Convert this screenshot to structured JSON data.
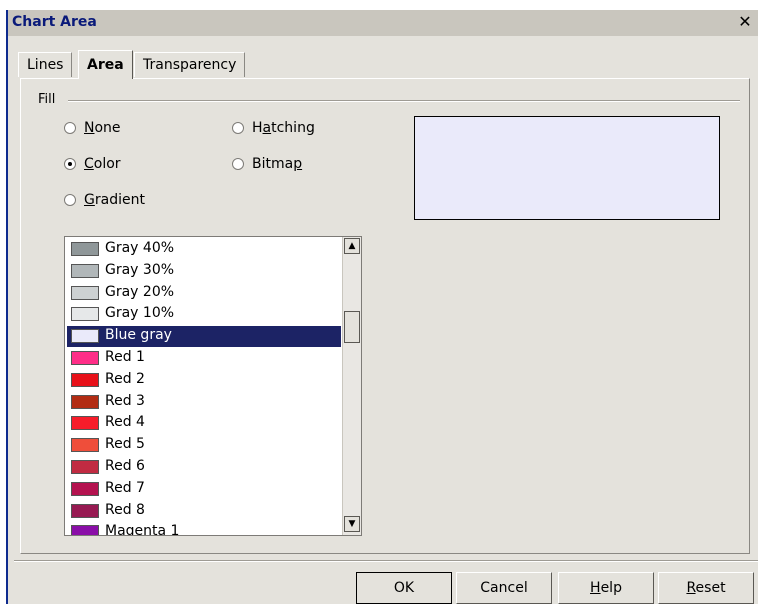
{
  "window": {
    "title": "Chart Area",
    "close_glyph": "✕"
  },
  "tabs": [
    {
      "label": "Lines"
    },
    {
      "label": "Area",
      "active": true
    },
    {
      "label": "Transparency"
    }
  ],
  "fill": {
    "label": "Fill",
    "options": [
      {
        "pre": "",
        "key": "N",
        "post": "one",
        "checked": false
      },
      {
        "pre": "",
        "key": "C",
        "post": "olor",
        "checked": true
      },
      {
        "pre": "",
        "key": "G",
        "post": "radient",
        "checked": false
      },
      {
        "pre": "H",
        "key": "a",
        "post": "tching",
        "checked": false
      },
      {
        "pre": "Bitma",
        "key": "p",
        "post": "",
        "checked": false
      }
    ]
  },
  "preview": {
    "color": "#eaeafa"
  },
  "color_list": {
    "items": [
      {
        "label": "Gray 40%",
        "color": "#8f9799"
      },
      {
        "label": "Gray 30%",
        "color": "#b1b7b9"
      },
      {
        "label": "Gray 20%",
        "color": "#cdd1d2"
      },
      {
        "label": "Gray 10%",
        "color": "#e6e8e9"
      },
      {
        "label": "Blue gray",
        "color": "#eaeafa",
        "selected": true
      },
      {
        "label": "Red 1",
        "color": "#ff2e88"
      },
      {
        "label": "Red 2",
        "color": "#e8111a"
      },
      {
        "label": "Red 3",
        "color": "#b22c14"
      },
      {
        "label": "Red 4",
        "color": "#f71c2a"
      },
      {
        "label": "Red 5",
        "color": "#ef4e3a"
      },
      {
        "label": "Red 6",
        "color": "#c12b42"
      },
      {
        "label": "Red 7",
        "color": "#b4124f"
      },
      {
        "label": "Red 8",
        "color": "#971a52"
      },
      {
        "label": "Magenta 1",
        "color": "#8a0ea8"
      }
    ],
    "scroll_up_glyph": "▲",
    "scroll_down_glyph": "▼"
  },
  "buttons": {
    "ok": {
      "pre": "",
      "key": "",
      "post": "OK"
    },
    "cancel": {
      "pre": "",
      "key": "",
      "post": "Cancel"
    },
    "help": {
      "pre": "",
      "key": "H",
      "post": "elp"
    },
    "reset": {
      "pre": "",
      "key": "R",
      "post": "eset"
    }
  }
}
